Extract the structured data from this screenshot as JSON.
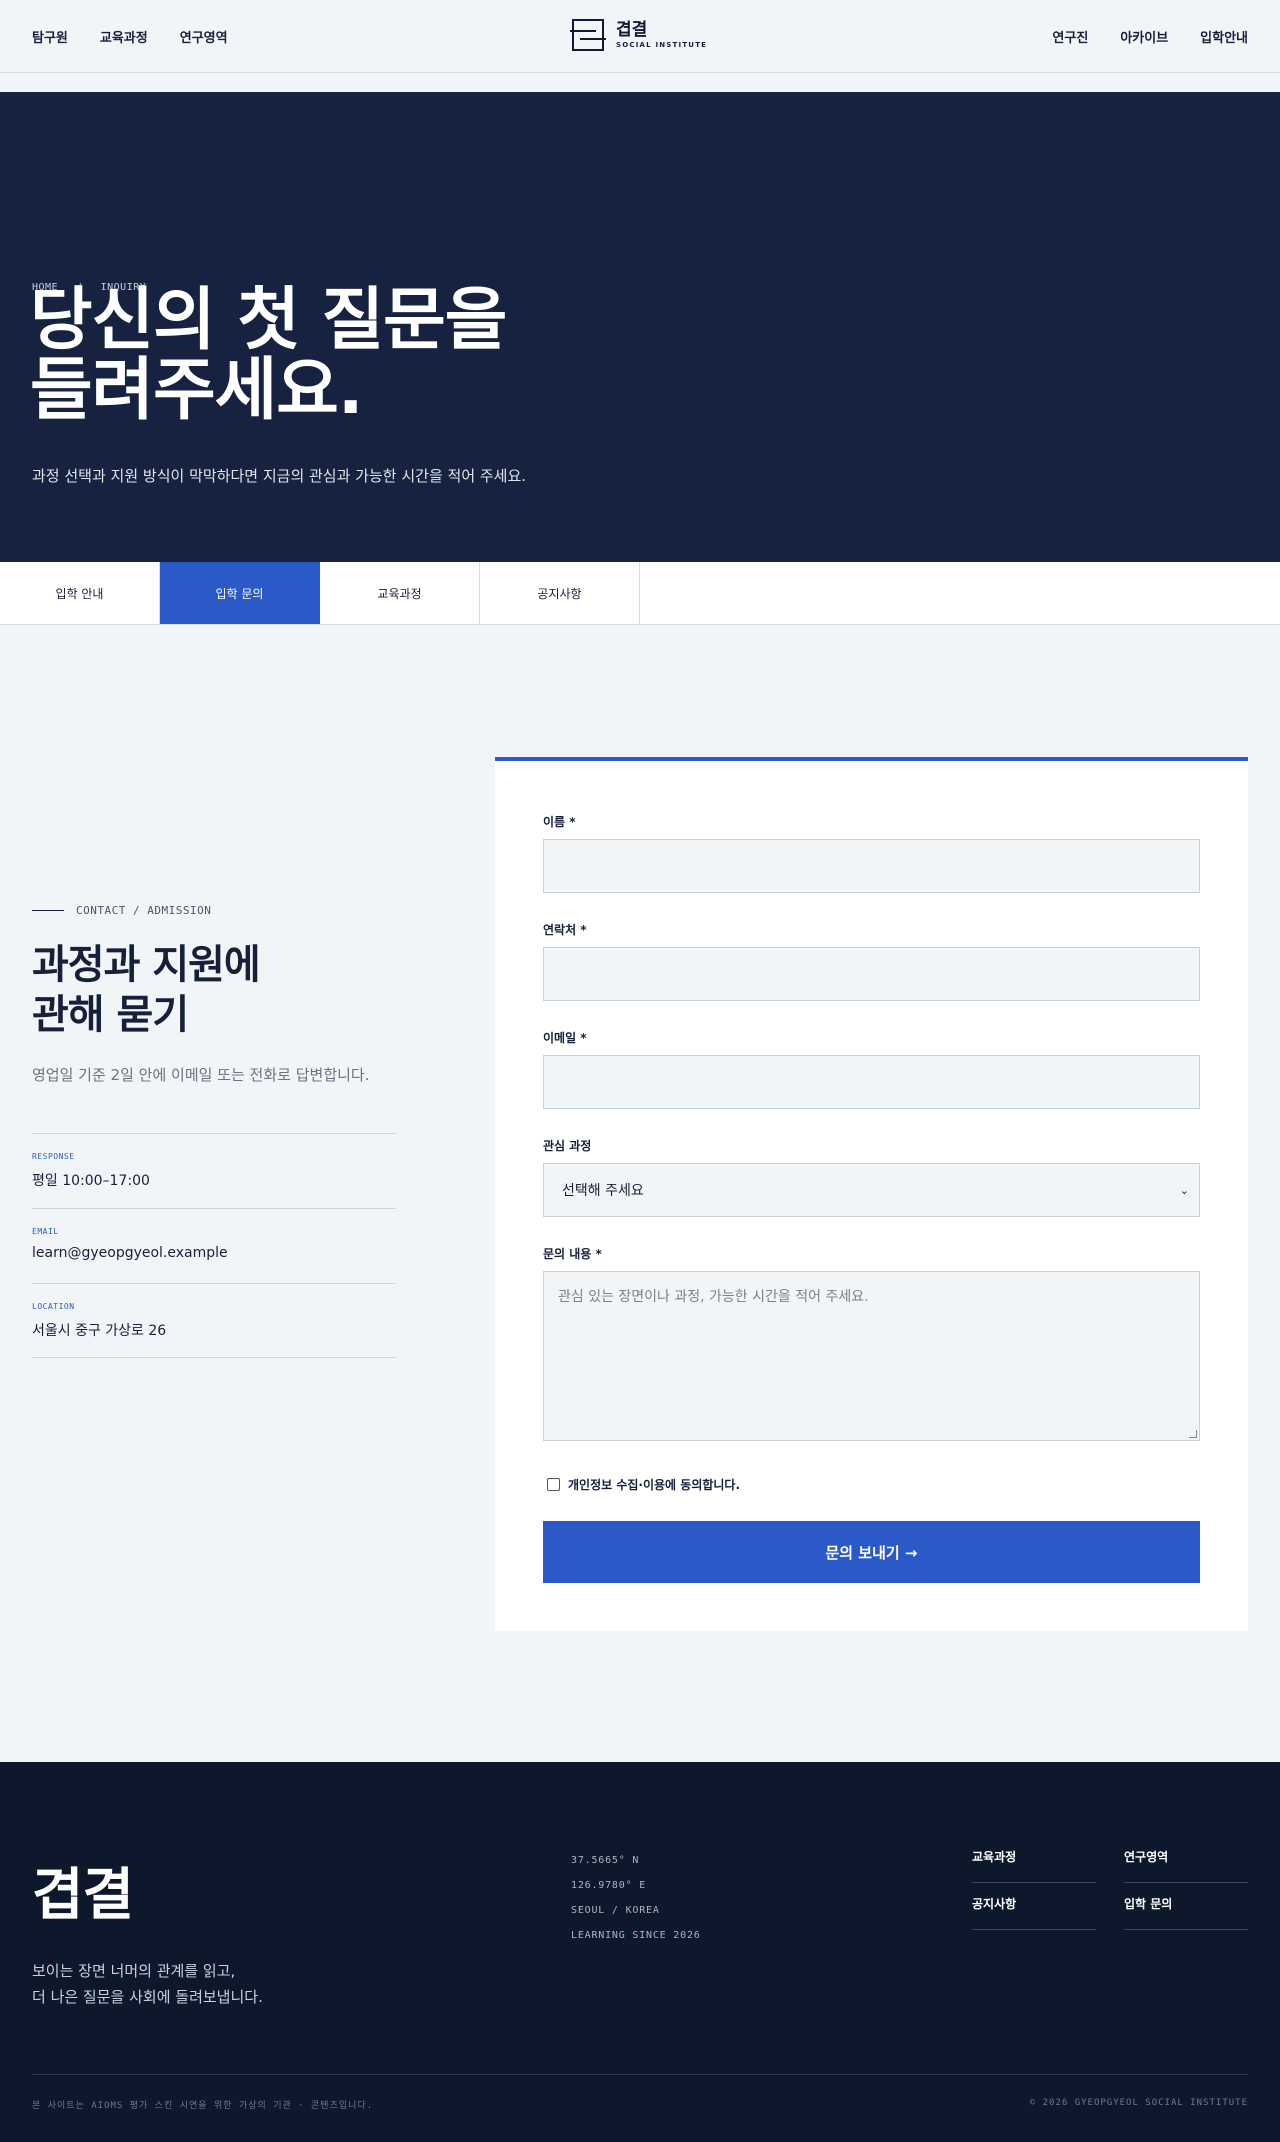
{
  "header": {
    "nav_left": [
      "탐구원",
      "교육과정",
      "연구영역"
    ],
    "nav_right": [
      "연구진",
      "아카이브",
      "입학안내"
    ],
    "logo_name": "겹결",
    "logo_sub": "SOCIAL INSTITUTE"
  },
  "hero": {
    "breadcrumb_home": "HOME",
    "breadcrumb_sep": "/",
    "breadcrumb_current": "INQUIRY",
    "title_line1": "당신의 첫 질문을",
    "title_line2": "들려주세요.",
    "description": "과정 선택과 지원 방식이 막막하다면 지금의 관심과 가능한 시간을 적어 주세요."
  },
  "tabs": [
    {
      "label": "입학 안내"
    },
    {
      "label": "입학 문의"
    },
    {
      "label": "교육과정"
    },
    {
      "label": "공지사항"
    }
  ],
  "contact": {
    "eyebrow": "CONTACT / ADMISSION",
    "title_line1": "과정과 지원에",
    "title_line2": "관해 묻기",
    "description": "영업일 기준 2일 안에 이메일 또는 전화로 답변합니다.",
    "items": [
      {
        "label": "RESPONSE",
        "value": "평일 10:00–17:00"
      },
      {
        "label": "EMAIL",
        "value": "learn@gyeopgyeol.example"
      },
      {
        "label": "LOCATION",
        "value": "서울시 중구 가상로 26"
      }
    ]
  },
  "form": {
    "name_label": "이름 *",
    "phone_label": "연락처 *",
    "email_label": "이메일 *",
    "course_label": "관심 과정",
    "course_value": "선택해 주세요",
    "message_label": "문의 내용 *",
    "message_placeholder": "관심 있는 장면이나 과정, 가능한 시간을 적어 주세요.",
    "agree_label": "개인정보 수집·이용에 동의합니다.",
    "submit_label": "문의 보내기 →"
  },
  "footer": {
    "logo": "겹결",
    "tagline_line1": "보이는 장면 너머의 관계를 읽고,",
    "tagline_line2": "더 나은 질문을 사회에 돌려보냅니다.",
    "coords": [
      "37.5665° N",
      "126.9780° E",
      "SEOUL / KOREA",
      "LEARNING SINCE 2026"
    ],
    "links": [
      "교육과정",
      "연구영역",
      "공지사항",
      "입학 문의"
    ],
    "note": "본 사이트는 AIOMS 평가 스킨 시연을 위한 가상의 기관 · 콘텐츠입니다.",
    "copyright": "© 2026 GYEOPGYEOL SOCIAL INSTITUTE"
  },
  "colors": {
    "accent": "#2b5ac8",
    "navy": "#162240",
    "footer_bg": "#0e182c",
    "page_bg": "#f2f5f7"
  }
}
